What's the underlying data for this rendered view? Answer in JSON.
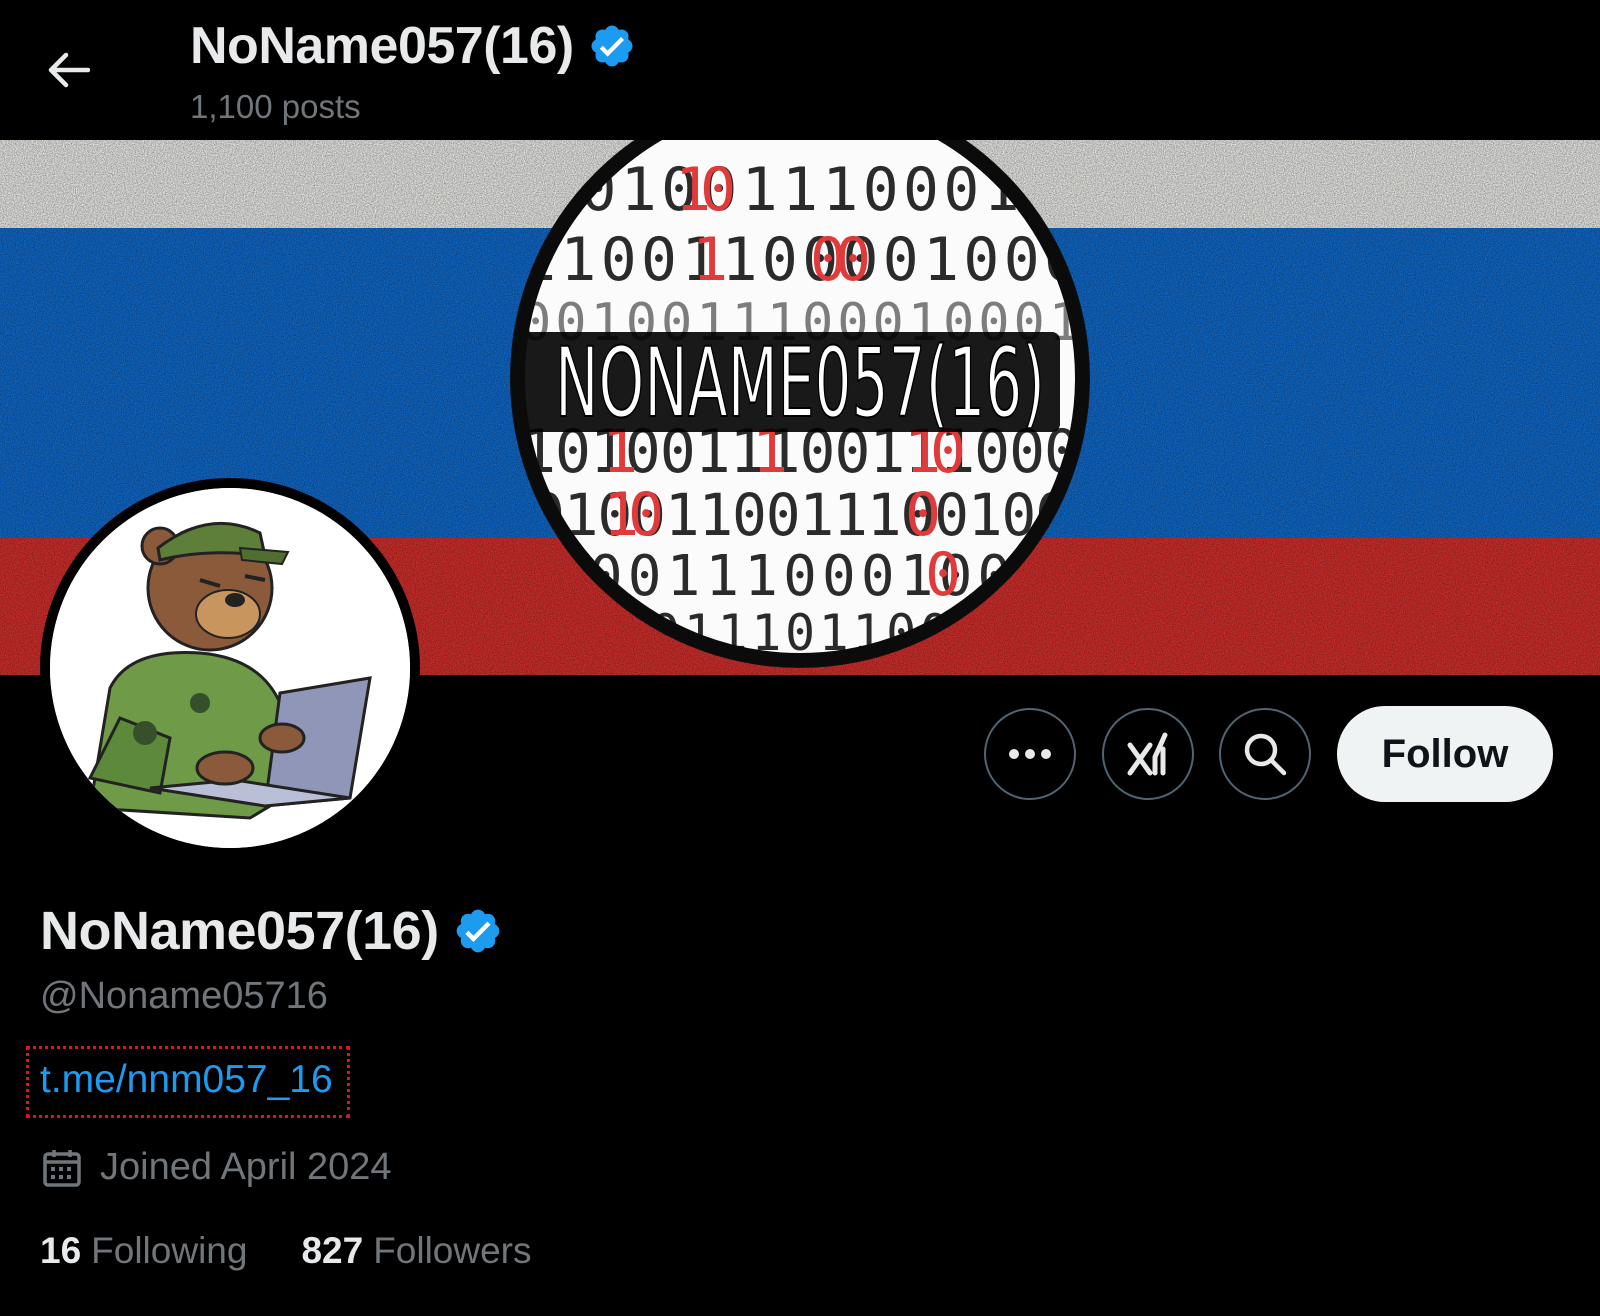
{
  "header": {
    "title": "NoName057(16)",
    "post_count": "1,100 posts"
  },
  "banner": {
    "overlay_text": "NONAME057(16)",
    "binary_rows": [
      "1010011100010",
      "11001100001000",
      "0010011100010001",
      "1010011100111000",
      "0100110011100100",
      "1001110001000",
      "011101100"
    ]
  },
  "actions": {
    "more_label": "•••",
    "follow_label": "Follow"
  },
  "profile": {
    "display_name": "NoName057(16)",
    "handle": "@Noname05716",
    "website": "t.me/nnm057_16",
    "joined": "Joined April 2024",
    "following_count": "16",
    "following_label": "Following",
    "followers_count": "827",
    "followers_label": "Followers"
  },
  "icons": {
    "back": "arrow-left-icon",
    "verified": "verified-badge-icon",
    "more": "more-icon",
    "grok": "grok-icon",
    "search": "search-icon",
    "calendar": "calendar-icon"
  },
  "colors": {
    "background": "#000000",
    "verified_blue": "#1d9bf0",
    "link_blue": "#1d9bf0",
    "muted_text": "#71767b",
    "flag_white": "#e9e9e6",
    "flag_blue": "#1169c9",
    "flag_red": "#d12f2c",
    "highlight_border": "#e0141f"
  }
}
